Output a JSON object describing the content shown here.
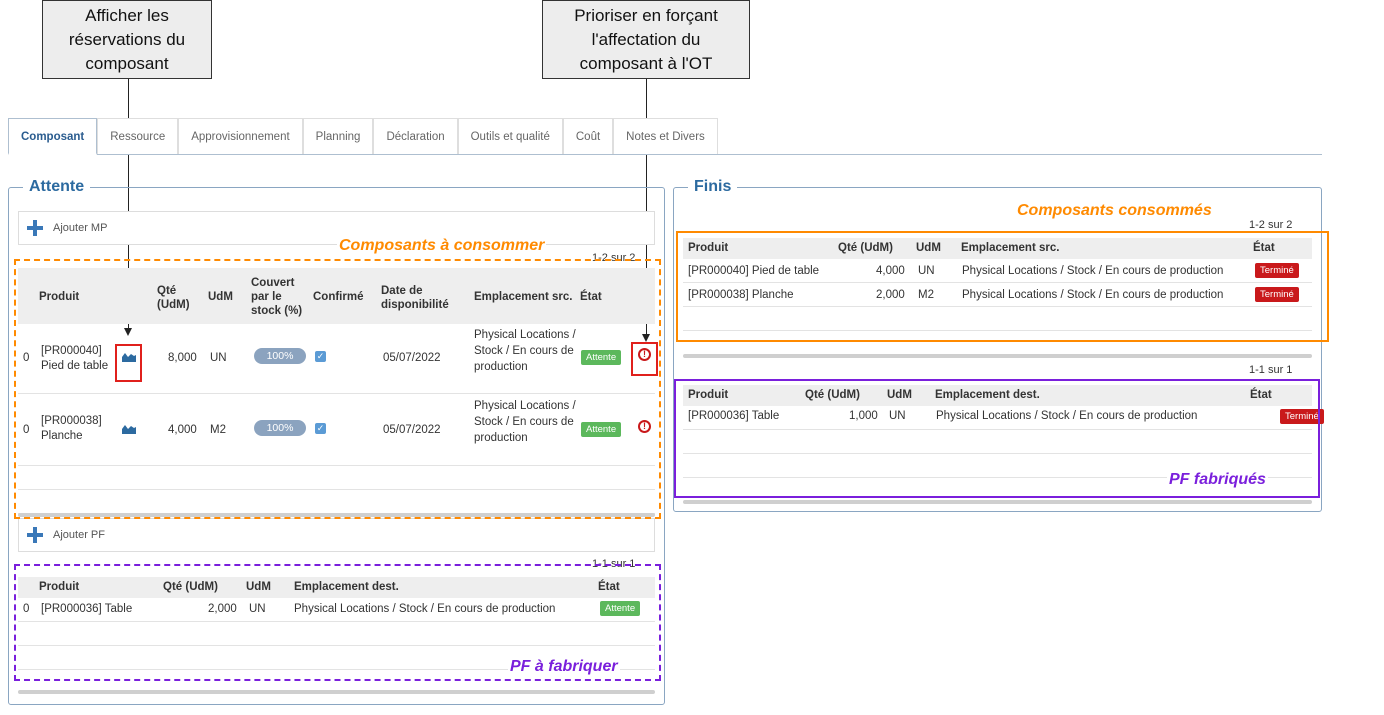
{
  "callouts": {
    "reservations": [
      "Afficher les",
      "réservations du",
      "composant"
    ],
    "prioritize": [
      "Prioriser en forçant",
      "l'affectation du",
      "composant à l'OT"
    ]
  },
  "tabs": [
    "Composant",
    "Ressource",
    "Approvisionnement",
    "Planning",
    "Déclaration",
    "Outils et qualité",
    "Coût",
    "Notes et Divers"
  ],
  "attente": {
    "title": "Attente",
    "add_mp": "Ajouter MP",
    "add_pf": "Ajouter PF",
    "components_counter": "1-2 sur 2",
    "components_headers": {
      "produit": "Produit",
      "qte": "Qté (UdM)",
      "udm": "UdM",
      "couvert": "Couvert par le stock (%)",
      "confirme": "Confirmé",
      "date": "Date de disponibilité",
      "emplacement": "Emplacement src.",
      "etat": "État"
    },
    "components": [
      {
        "seq": "0",
        "produit": "[PR000040] Pied de table",
        "qte": "8,000",
        "udm": "UN",
        "couvert": "100%",
        "date": "05/07/2022",
        "emplacement": "Physical Locations / Stock / En cours de production",
        "etat": "Attente"
      },
      {
        "seq": "0",
        "produit": "[PR000038] Planche",
        "qte": "4,000",
        "udm": "M2",
        "couvert": "100%",
        "date": "05/07/2022",
        "emplacement": "Physical Locations / Stock / En cours de production",
        "etat": "Attente"
      }
    ],
    "products_counter": "1-1 sur 1",
    "products_headers": {
      "produit": "Produit",
      "qte": "Qté (UdM)",
      "udm": "UdM",
      "emplacement": "Emplacement dest.",
      "etat": "État"
    },
    "products": [
      {
        "seq": "0",
        "produit": "[PR000036] Table",
        "qte": "2,000",
        "udm": "UN",
        "emplacement": "Physical Locations / Stock / En cours de production",
        "etat": "Attente"
      }
    ]
  },
  "finis": {
    "title": "Finis",
    "consumed_counter": "1-2 sur 2",
    "consumed_headers": {
      "produit": "Produit",
      "qte": "Qté (UdM)",
      "udm": "UdM",
      "emplacement": "Emplacement src.",
      "etat": "État"
    },
    "consumed": [
      {
        "produit": "[PR000040] Pied de table",
        "qte": "4,000",
        "udm": "UN",
        "emplacement": "Physical Locations / Stock / En cours de production",
        "etat": "Terminé"
      },
      {
        "produit": "[PR000038] Planche",
        "qte": "2,000",
        "udm": "M2",
        "emplacement": "Physical Locations / Stock / En cours de production",
        "etat": "Terminé"
      }
    ],
    "produced_counter": "1-1 sur 1",
    "produced_headers": {
      "produit": "Produit",
      "qte": "Qté (UdM)",
      "udm": "UdM",
      "emplacement": "Emplacement dest.",
      "etat": "État"
    },
    "produced": [
      {
        "produit": "[PR000036] Table",
        "qte": "1,000",
        "udm": "UN",
        "emplacement": "Physical Locations / Stock / En cours de production",
        "etat": "Terminé"
      }
    ]
  },
  "annotations": {
    "to_consume": "Composants à consommer",
    "to_make": "PF à fabriquer",
    "consumed": "Composants consommés",
    "made": "PF fabriqués"
  },
  "colors": {
    "accent": "#2c6aa0",
    "orange": "#ff8a00",
    "purple": "#7a1fdc",
    "red": "#e0201c",
    "green": "#5cb85c"
  },
  "icons": {
    "reservations": "area-chart-icon",
    "prioritize": "exclamation-circle-icon",
    "add": "plus-icon"
  }
}
